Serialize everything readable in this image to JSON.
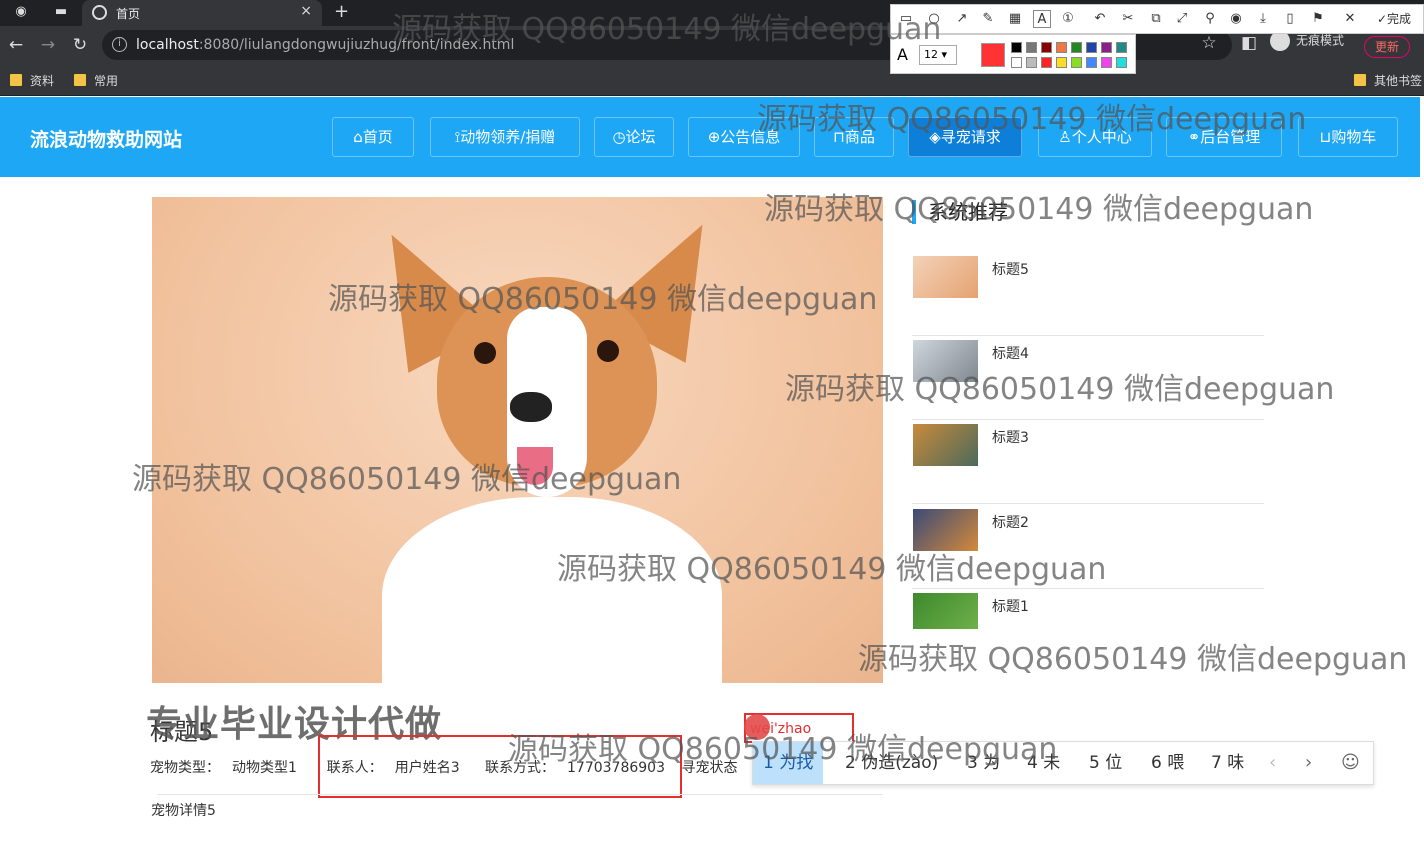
{
  "browser": {
    "tab_title": "首页",
    "new_tab": "+",
    "url_host": "localhost",
    "url_rest": ":8080/liulangdongwujiuzhug/front/index.html",
    "incognito_label": "无痕模式",
    "update_label": "更新",
    "bookmarks": [
      "资料",
      "常用"
    ],
    "other_bookmarks": "其他书签"
  },
  "annotation_tool": {
    "done_label": "完成",
    "font_label": "A",
    "font_size": "12",
    "current_color": "#f33333"
  },
  "site": {
    "title": "流浪动物救助网站",
    "nav": [
      {
        "label": "⌂首页"
      },
      {
        "label": "⟟动物领养/捐赠"
      },
      {
        "label": "◷论坛"
      },
      {
        "label": "⊕公告信息"
      },
      {
        "label": "⊓商品"
      },
      {
        "label": "◈寻宠请求"
      },
      {
        "label": "♙个人中心"
      },
      {
        "label": "⚭后台管理"
      },
      {
        "label": "⊔购物车"
      }
    ],
    "active_nav": "寻宠请求"
  },
  "recommend": {
    "heading": "系统推荐",
    "items": [
      {
        "label": "标题5"
      },
      {
        "label": "标题4"
      },
      {
        "label": "标题3"
      },
      {
        "label": "标题2"
      },
      {
        "label": "标题1"
      }
    ]
  },
  "detail": {
    "title": "标题5",
    "pet_type_label": "宠物类型：",
    "pet_type": "动物类型1",
    "contact_label": "联系人：",
    "contact": "用户姓名3",
    "phone_label": "联系方式：",
    "phone": "17703786903",
    "status_label": "寻宠状态",
    "description": "宠物详情5"
  },
  "overlay_text": "专业毕业设计代做",
  "ime": {
    "pinyin": "wei'zhao",
    "candidates": [
      "1 为找",
      "2 伪造(zào)",
      "3 为",
      "4 未",
      "5 位",
      "6 喂",
      "7 味"
    ],
    "prev": "‹",
    "next": "›",
    "emoji": "☺"
  },
  "watermark": "源码获取 QQ86050149 微信deepguan"
}
